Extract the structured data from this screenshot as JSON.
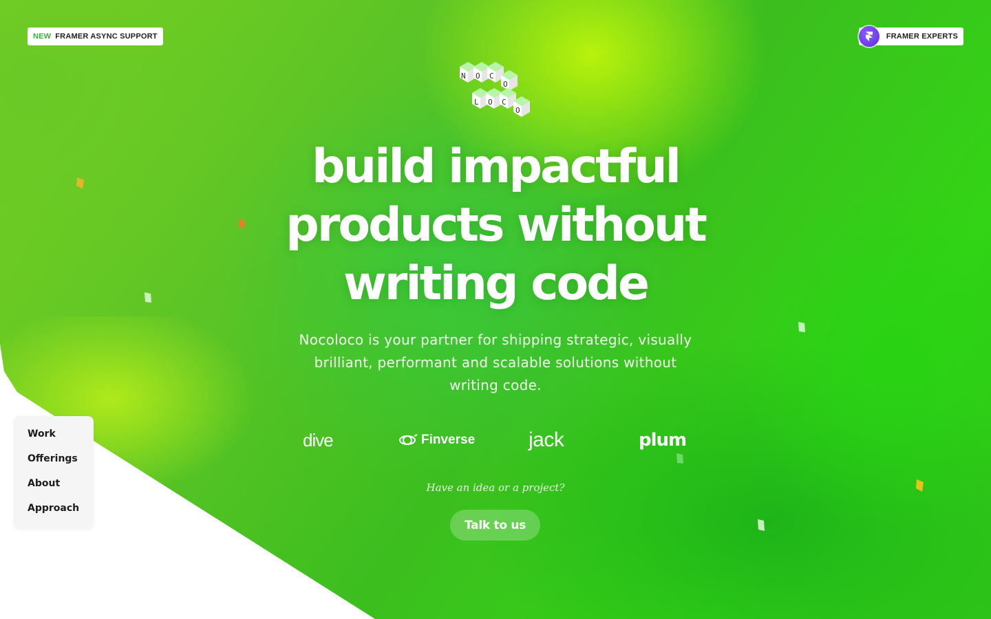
{
  "colors": {
    "hero_green": "#3cbe1f",
    "lime_highlight": "#bef50a",
    "new_tag": "#39b52b",
    "framer_badge": "#6a3cf0",
    "confetti_orange": "#f07a2a",
    "confetti_yellow": "#f5c518"
  },
  "top_left_pill": {
    "tag": "NEW",
    "label": "FRAMER ASYNC SUPPORT"
  },
  "top_right_pill": {
    "badge_icon": "framer-logo-icon",
    "label": "FRAMER EXPERTS"
  },
  "logo": {
    "letters_top": [
      "N",
      "O",
      "C",
      "O"
    ],
    "letters_bottom": [
      "L",
      "O",
      "C",
      "O"
    ]
  },
  "hero": {
    "headline_line1": "build impactful",
    "headline_line2": "products without",
    "headline_line3": "writing code",
    "subtext_line1": "Nocoloco is your partner for shipping strategic, visually",
    "subtext_line2": "brilliant, performant and scalable solutions without",
    "subtext_line3": "writing code."
  },
  "clients": [
    {
      "name": "dive"
    },
    {
      "name": "Finverse"
    },
    {
      "name": "jack"
    },
    {
      "name": "plum"
    }
  ],
  "cta": {
    "prompt": "Have an idea or a project?",
    "button_label": "Talk to us"
  },
  "side_nav": {
    "items": [
      "Work",
      "Offerings",
      "About",
      "Approach"
    ]
  }
}
